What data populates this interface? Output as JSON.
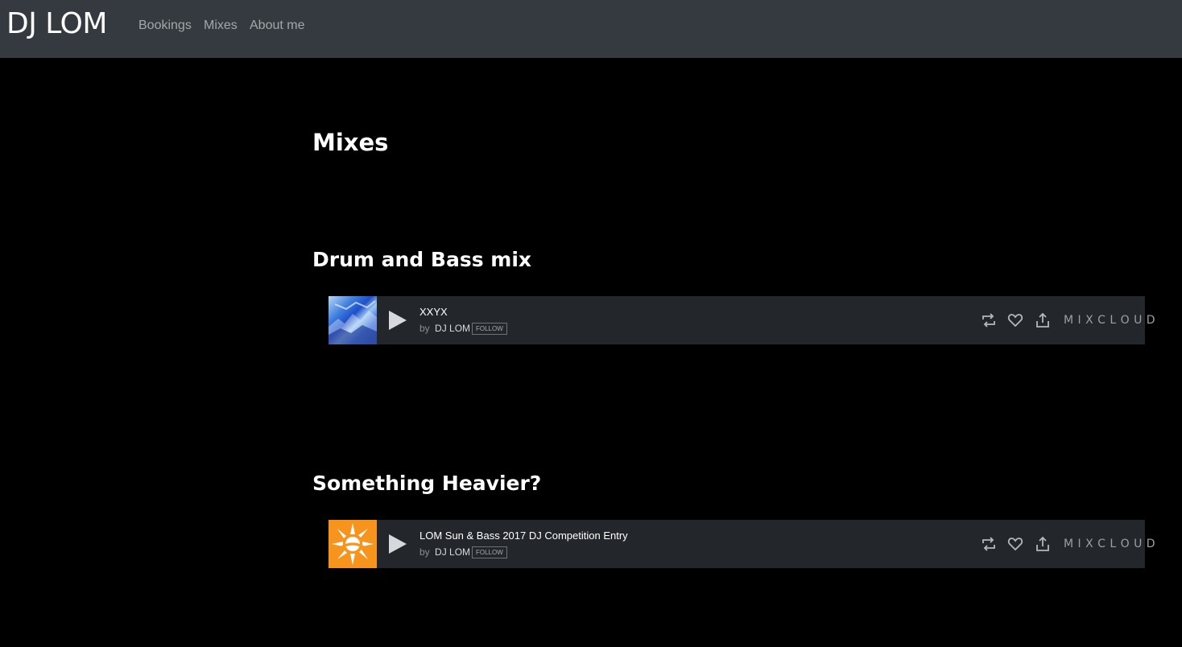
{
  "nav": {
    "brand": "DJ LOM",
    "links": [
      "Bookings",
      "Mixes",
      "About me"
    ]
  },
  "page": {
    "title": "Mixes"
  },
  "sections": [
    {
      "heading": "Drum and Bass mix",
      "player": {
        "track_title": "XXYX",
        "by": "by",
        "artist": "DJ LOM",
        "follow_label": "FOLLOW",
        "artwork": "blue-abstract-artwork",
        "brand": "M I X C L O U D"
      }
    },
    {
      "heading": "Something Heavier?",
      "player": {
        "track_title": "LOM Sun & Bass 2017 DJ Competition Entry",
        "by": "by",
        "artist": "DJ LOM",
        "follow_label": "FOLLOW",
        "artwork": "orange-sun-logo-artwork",
        "brand": "M I X C L O U D"
      }
    }
  ],
  "icons": [
    "play-icon",
    "repost-icon",
    "heart-icon",
    "share-icon"
  ],
  "colors": {
    "navbar": "#343a40",
    "background": "#000000",
    "player": "#23262a",
    "accent_orange": "#f7941d"
  }
}
